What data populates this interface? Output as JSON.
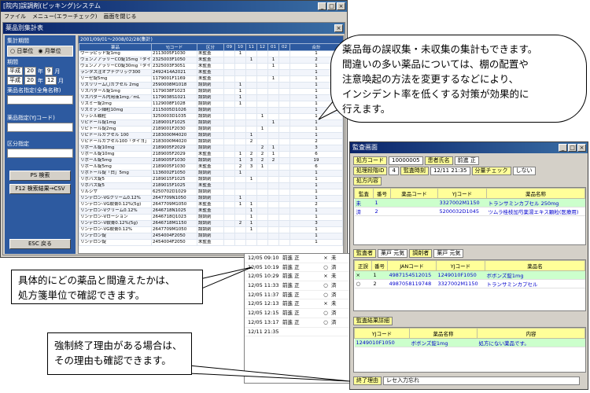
{
  "main_window": {
    "title": "[院内]誤調剤(ピッキング)システム",
    "menu": [
      "ファイル",
      "メニュー(エラーチェック)",
      "画面を閉じる"
    ],
    "sub_title": "薬品別集計表",
    "left_panel": {
      "period_label": "集計期間",
      "period_options": [
        "日単位",
        "月単位"
      ],
      "date_section_label": "期間",
      "era_from": "平成",
      "year_from": "20",
      "month_from": "9",
      "era_to": "平成",
      "year_to": "20",
      "month_to": "12",
      "year_unit": "年",
      "month_unit": "月",
      "name_filter_label": "薬品名指定(全角名称)",
      "code_filter_label": "薬品指定(YJコード)",
      "category_label": "区分指定",
      "search_button": "PS 検索",
      "csv_button": "F12 検索結果→CSV",
      "close_button": "ESC 戻る"
    },
    "grid": {
      "caption": "2001/09/01～2008/02/28(集計)",
      "headers": [
        "薬品",
        "YJコード",
        "区分",
        "09",
        "10",
        "11",
        "12",
        "01",
        "02",
        "合計"
      ],
      "rows": [
        [
          "ウーラピッド錠1mg",
          "2113005F1030",
          "未監査",
          "",
          "1",
          "",
          "",
          "",
          "",
          "1"
        ],
        [
          "ヴェンノアラリーCO錠15mg「タイヨー」",
          "2325003F1050",
          "未監査",
          "",
          "",
          "1",
          "",
          "1",
          "",
          "2"
        ],
        [
          "ヴェンノアラリーCO錠30mg「タイヨー」",
          "2325003F3051",
          "未監査",
          "",
          "",
          "",
          "",
          "1",
          "",
          "1"
        ],
        [
          "ランタス注オプチクリック300",
          "2492414A2021",
          "未監査",
          "",
          "",
          "",
          "",
          "",
          "",
          "1"
        ],
        [
          "リーゼ錠5mg",
          "1179001F1169",
          "未監査",
          "",
          "",
          "",
          "",
          "1",
          "",
          "1"
        ],
        [
          "リズリリーム〇カプセル 2mg",
          "2590008M1018",
          "誤調剤",
          "",
          "1",
          "",
          "",
          "",
          "",
          "1"
        ],
        [
          "リスパダール錠1mg",
          "1179038F1023",
          "誤調剤",
          "",
          "1",
          "",
          "",
          "",
          "",
          "1"
        ],
        [
          "リスパダール内用液1mg／mL",
          "1179038S1021",
          "誤調剤",
          "",
          "1",
          "",
          "",
          "",
          "",
          "1"
        ],
        [
          "リスミー錠2mg",
          "1129008F1028",
          "誤調剤",
          "",
          "1",
          "",
          "",
          "",
          "",
          "1"
        ],
        [
          "リズミデン細粒10mg",
          "2115005D1026",
          "誤調剤",
          "",
          "",
          "",
          "",
          "",
          "",
          "1"
        ],
        [
          "リッシル顆粒",
          "3250003D1035",
          "誤調剤",
          "",
          "",
          "",
          "1",
          "",
          "",
          "1"
        ],
        [
          "リピドール錠1mg",
          "2189001F1025",
          "誤調剤",
          "",
          "",
          "",
          "",
          "1",
          "",
          "1"
        ],
        [
          "リピトール錠2mg",
          "2189001F2030",
          "誤調剤",
          "",
          "",
          "",
          "1",
          "",
          "",
          "1"
        ],
        [
          "リピドールカプセル 100",
          "2183000M4020",
          "誤調剤",
          "",
          "",
          "1",
          "",
          "",
          "",
          "1"
        ],
        [
          "リピドールカプセル100「タイヨ」",
          "2183000M4020",
          "誤調剤",
          "",
          "",
          "2",
          "",
          "",
          "",
          "2"
        ],
        [
          "リポール錠10mg",
          "2189005F2029",
          "誤調剤",
          "",
          "",
          "",
          "2",
          "1",
          "",
          "3"
        ],
        [
          "リポール錠10mg",
          "2189005F2029",
          "未監査",
          "",
          "1",
          "2",
          "2",
          "1",
          "",
          "6"
        ],
        [
          "リポール錠5mg",
          "2189005F1030",
          "誤調剤",
          "",
          "1",
          "3",
          "2",
          "2",
          "",
          "19"
        ],
        [
          "リポール錠5mg",
          "2189005F1030",
          "未監査",
          "",
          "2",
          "3",
          "1",
          "",
          "",
          "6"
        ],
        [
          "リポトール錠「白」5mg",
          "1136002F1050",
          "誤調剤",
          "",
          "1",
          "",
          "",
          "",
          "",
          "1"
        ],
        [
          "リボバス錠5",
          "2189015F1025",
          "誤調剤",
          "",
          "",
          "1",
          "",
          "",
          "",
          "1"
        ],
        [
          "リボバス錠5",
          "2189015F1025",
          "未監査",
          "",
          "",
          "",
          "",
          "",
          "",
          "1"
        ],
        [
          "リルシザ",
          "6250702D1029",
          "誤調剤",
          "",
          "",
          "",
          "",
          "",
          "",
          "1"
        ],
        [
          "リンデロン-VGクリーム0.12%",
          "2647709N1050",
          "誤調剤",
          "",
          "1",
          "",
          "",
          "",
          "",
          "1"
        ],
        [
          "リンデロン-VG軟膏0.12%(5g)",
          "2647709M1050",
          "未監査",
          "",
          "1",
          "1",
          "",
          "",
          "",
          "2"
        ],
        [
          "リンデロン-Vクリーム0.12%",
          "2646718N1025",
          "未監査",
          "",
          "",
          "1",
          "",
          "",
          "",
          "1"
        ],
        [
          "リンデロン-Vローション",
          "2646718Q1023",
          "誤調剤",
          "",
          "",
          "1",
          "",
          "",
          "",
          "1"
        ],
        [
          "リンデロン-V軟膏0.12%(5g)",
          "2646718M1150",
          "誤調剤",
          "",
          "2",
          "1",
          "",
          "",
          "",
          "3"
        ],
        [
          "リンデロン-VG軟膏0.12%",
          "2647709M1050",
          "誤調剤",
          "",
          "",
          "1",
          "",
          "",
          "",
          "1"
        ],
        [
          "リンデロン錠",
          "2454004F2050",
          "誤調剤",
          "",
          "",
          "",
          "",
          "",
          "",
          "1"
        ],
        [
          "リンデロン錠",
          "2454004F2050",
          "未監査",
          "",
          "",
          "",
          "",
          "",
          "",
          "1"
        ]
      ]
    }
  },
  "history_window": {
    "rows": [
      [
        "12/05 09:10",
        "前進 正",
        "×",
        "未"
      ],
      [
        "12/05 10:19",
        "前進 正",
        "○",
        "済"
      ],
      [
        "12/05 10:29",
        "前進 正",
        "×",
        "未"
      ],
      [
        "12/05 11:33",
        "前進 正",
        "○",
        "済"
      ],
      [
        "12/05 11:37",
        "前進 正",
        "○",
        "済"
      ],
      [
        "12/05 12:13",
        "前進 正",
        "×",
        "未"
      ],
      [
        "12/05 12:15",
        "前進 正",
        "○",
        "済"
      ],
      [
        "12/05 13:17",
        "前進 正",
        "○",
        "済"
      ],
      [
        "12/11 21:35",
        "",
        "",
        ""
      ]
    ]
  },
  "right_window": {
    "title": "監査画面",
    "top_labels": {
      "rx_no_label": "処方コード",
      "rx_no_value": "10000005",
      "patient_label": "患者氏名",
      "patient_value": "前進 正",
      "stage_label": "処理段階ID",
      "stage_value": "4",
      "audit_time_label": "監査時刻",
      "audit_time_value": "12/11 21:35",
      "split_label": "分量チェック",
      "split_value": "しない",
      "content_label": "処方内容"
    },
    "rx_table": {
      "headers": [
        "監査",
        "番号",
        "薬品コード",
        "YJコード",
        "薬品名称"
      ],
      "rows": [
        [
          "未",
          "1",
          "",
          "3327002M1150",
          "トランサミンカプセル 250mg"
        ],
        [
          "済",
          "2",
          "",
          "5200032D1045",
          "ツムラ桂枝加芍薬湯エキス顆粒(医療用)"
        ]
      ]
    },
    "auditor_row": {
      "audit_pharmacist_label": "監査者",
      "audit_pharmacist_value": "薬戸 元気",
      "dispenser_label": "調剤者",
      "dispenser_value": "薬戸 元気"
    },
    "jan_table": {
      "headers": [
        "正誤",
        "番号",
        "JANコード",
        "YJコード",
        "薬品名"
      ],
      "rows": [
        [
          "×",
          "1",
          "4987154512015",
          "1249010F1050",
          "ボボンズ錠1mg"
        ],
        [
          "○",
          "2",
          "4987058119748",
          "3327002M1150",
          "トランサミンカプセル"
        ]
      ]
    },
    "result_label": "監査結果詳細",
    "result_table": {
      "headers": [
        "YJコード",
        "薬品名称",
        "内容"
      ],
      "rows": [
        [
          "1249010F1050",
          "ボボンズ錠1mg",
          "処方にない薬品です。"
        ]
      ]
    },
    "end_reason_label": "終了理由",
    "end_reason_value": "レセ入力忘れ"
  },
  "callouts": {
    "top_right": [
      "薬品毎の誤収集・未収集の集計もできます。",
      "間違いの多い薬品については、棚の配置や",
      "注意喚起の方法を変更するなどにより、",
      "インシデント率を低くする対策が効果的に",
      "行えます。"
    ],
    "middle_left": [
      "具体的にどの薬品と間違えたかは、",
      "処方箋単位で確認できます。"
    ],
    "bottom_left": [
      "強制終了理由がある場合は、",
      "その理由も確認できます。"
    ]
  }
}
